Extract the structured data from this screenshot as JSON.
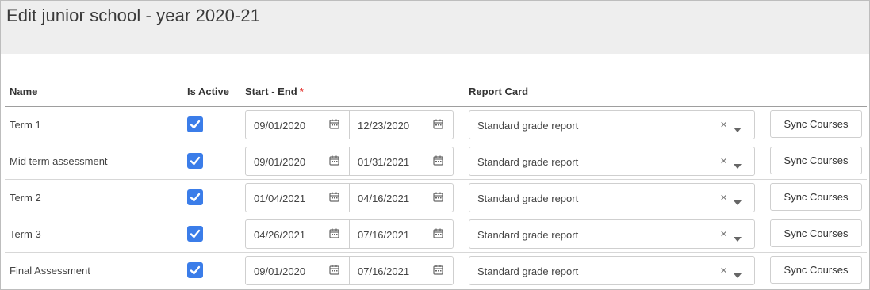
{
  "page_title": "Edit junior school - year 2020-21",
  "table": {
    "headers": {
      "name": "Name",
      "is_active": "Is Active",
      "start_end": "Start - End",
      "required_mark": "*",
      "report_card": "Report Card"
    },
    "rows": [
      {
        "name": "Term 1",
        "active": true,
        "start": "09/01/2020",
        "end": "12/23/2020",
        "report_card": "Standard grade report",
        "sync_label": "Sync Courses"
      },
      {
        "name": "Mid term assessment",
        "active": true,
        "start": "09/01/2020",
        "end": "01/31/2021",
        "report_card": "Standard grade report",
        "sync_label": "Sync Courses"
      },
      {
        "name": "Term 2",
        "active": true,
        "start": "01/04/2021",
        "end": "04/16/2021",
        "report_card": "Standard grade report",
        "sync_label": "Sync Courses"
      },
      {
        "name": "Term 3",
        "active": true,
        "start": "04/26/2021",
        "end": "07/16/2021",
        "report_card": "Standard grade report",
        "sync_label": "Sync Courses"
      },
      {
        "name": "Final Assessment",
        "active": true,
        "start": "09/01/2020",
        "end": "07/16/2021",
        "report_card": "Standard grade report",
        "sync_label": "Sync Courses"
      }
    ]
  },
  "icons": {
    "checkbox": "checkmark-icon",
    "calendar": "calendar-icon",
    "clear": "clear-x-icon",
    "dropdown": "chevron-down-icon"
  },
  "colors": {
    "checkbox": "#3b7de9",
    "required": "#e53935",
    "header_bg": "#eeeeee"
  }
}
